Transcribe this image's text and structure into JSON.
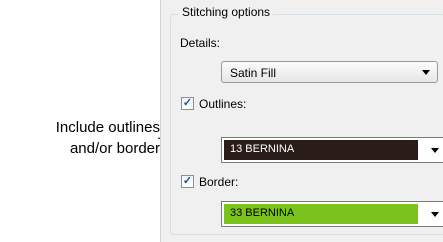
{
  "callout": {
    "line1": "Include outlines",
    "line2": "and/or border"
  },
  "stitching_options": {
    "title": "Stitching options",
    "details_label": "Details:",
    "details_value": "Satin Fill",
    "outlines": {
      "label": "Outlines:",
      "checked": true,
      "color_name": "13 BERNINA",
      "color_hex": "#2a1c19",
      "text_color": "#ffffff"
    },
    "border": {
      "label": "Border:",
      "checked": true,
      "color_name": "33 BERNINA",
      "color_hex": "#7bc21c",
      "text_color": "#000000"
    }
  }
}
